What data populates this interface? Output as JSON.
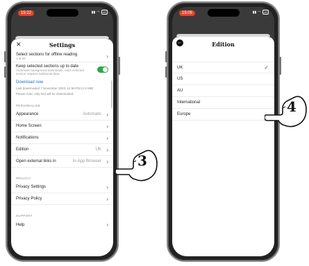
{
  "left": {
    "status": {
      "time": "15:22",
      "network": "4G"
    },
    "header": {
      "title": "Settings",
      "close_icon": "close-icon"
    },
    "offline": {
      "label": "Select sections for offline reading",
      "sub": "1 of 26"
    },
    "keep_updated": {
      "label": "Keep selected sections up to date",
      "desc_line1": "Automatic background downloads, each selected",
      "desc_line2": "section requires additional data.",
      "toggle_on": true
    },
    "download": {
      "link": "Download now",
      "last": "Last downloaded 7 November 2023, 12:56 PM (2.9 MB)",
      "note": "Please note: only text will be downloaded."
    },
    "personalise": {
      "heading": "PERSONALISE",
      "items": [
        {
          "label": "Appearance",
          "value": "Automatic"
        },
        {
          "label": "Home Screen",
          "value": ""
        },
        {
          "label": "Notifications",
          "value": ""
        },
        {
          "label": "Edition",
          "value": "UK"
        },
        {
          "label": "Open external links in",
          "value": "In-App Browser"
        }
      ]
    },
    "privacy": {
      "heading": "PRIVACY",
      "items": [
        {
          "label": "Privacy Settings"
        },
        {
          "label": "Privacy Policy"
        }
      ]
    },
    "support": {
      "heading": "SUPPORT",
      "items": [
        {
          "label": "Help"
        }
      ]
    }
  },
  "right": {
    "status": {
      "time": "15:05",
      "network": "4G"
    },
    "header": {
      "title": "Edition",
      "back_icon": "back-arrow-icon"
    },
    "editions": [
      {
        "label": "UK",
        "selected": true
      },
      {
        "label": "US",
        "selected": false
      },
      {
        "label": "AU",
        "selected": false
      },
      {
        "label": "International",
        "selected": false
      },
      {
        "label": "Europe",
        "selected": false
      }
    ]
  },
  "callouts": [
    {
      "number": "3",
      "icon": "pointing-hand-icon"
    },
    {
      "number": "4",
      "icon": "pointing-hand-icon"
    }
  ],
  "colors": {
    "accent_red": "#e0452c",
    "toggle_green": "#2fa74a",
    "link_blue": "#1b6fc7"
  }
}
